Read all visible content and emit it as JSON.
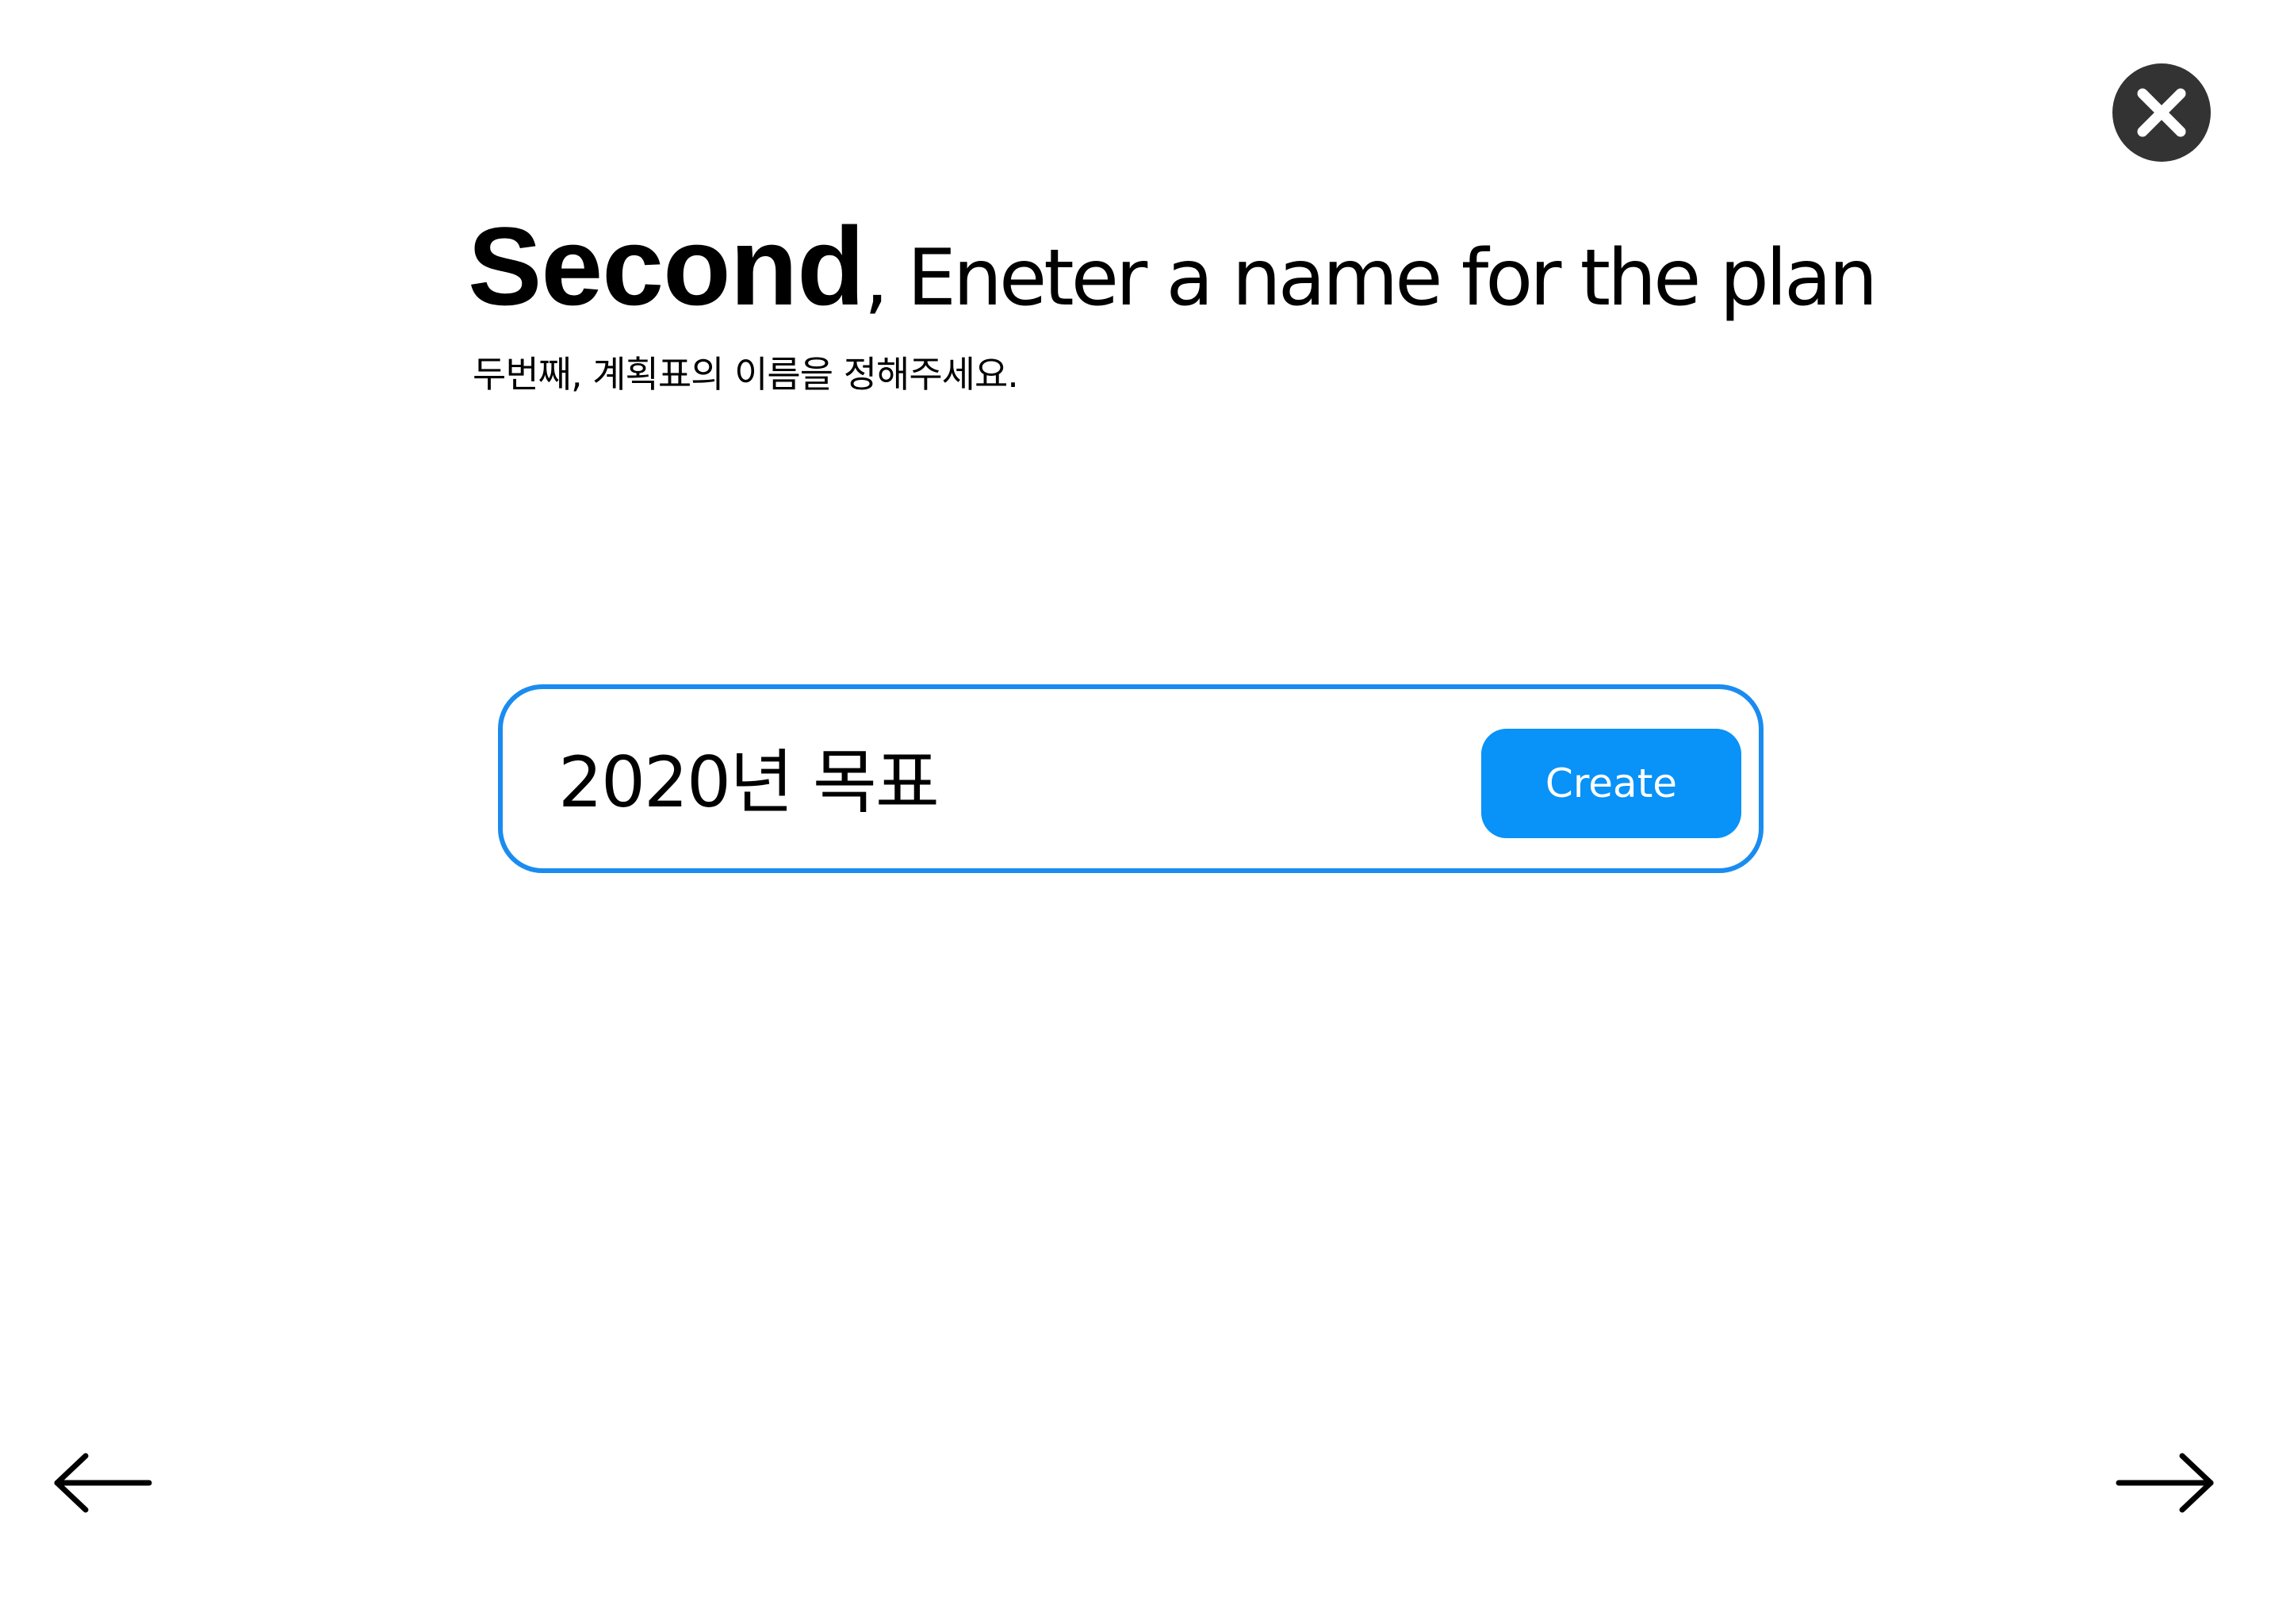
{
  "header": {
    "title_strong": "Second",
    "title_rest": ", Eneter a name for the plan",
    "subtitle": "두번째, 계획표의 이름을 정해주세요."
  },
  "plan_name": {
    "value": "2020년 목표"
  },
  "buttons": {
    "create_label": "Create",
    "close_icon": "close-icon",
    "back_icon": "arrow-left-icon",
    "next_icon": "arrow-right-icon"
  },
  "colors": {
    "accent": "#0992f7",
    "border": "#1a8cf0",
    "close_bg": "#333333"
  }
}
